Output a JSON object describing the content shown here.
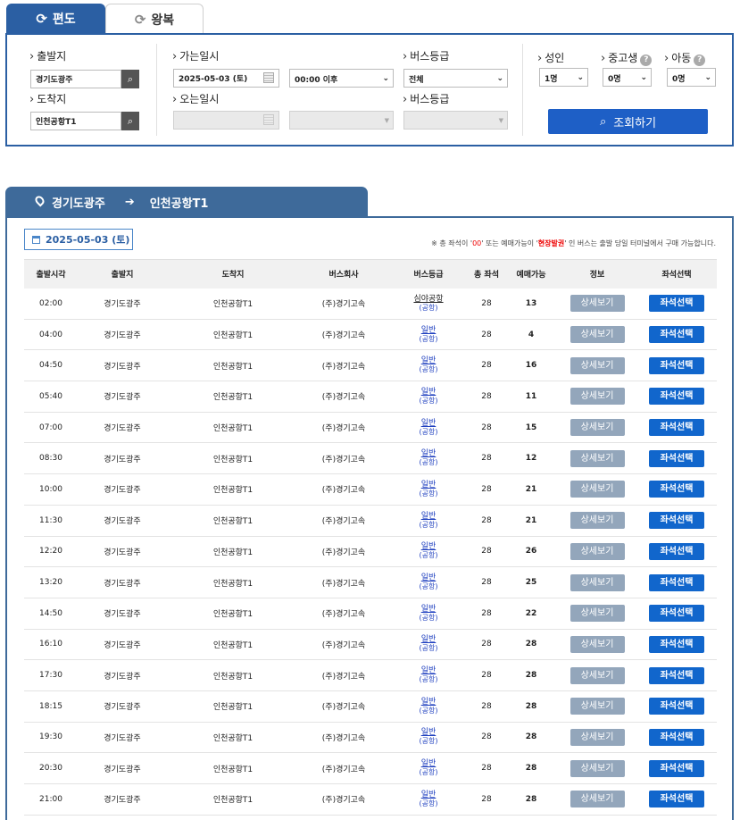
{
  "tabs": [
    {
      "label": "편도",
      "active": true
    },
    {
      "label": "왕복",
      "active": false
    }
  ],
  "search": {
    "departure_label": "출발지",
    "departure_value": "경기도광주",
    "arrival_label": "도착지",
    "arrival_value": "인천공항T1",
    "go_date_label": "가는일시",
    "go_date_value": "2025-05-03 (토)",
    "go_time_value": "00:00 이후",
    "return_date_label": "오는일시",
    "bus_grade_label": "버스등급",
    "bus_grade_value": "전체",
    "bus_grade2_label": "버스등급",
    "adult_label": "성인",
    "adult_value": "1명",
    "youth_label": "중고생",
    "youth_value": "0명",
    "child_label": "아동",
    "child_value": "0명",
    "inquiry_label": "조회하기"
  },
  "route": {
    "from": "경기도광주",
    "to": "인천공항T1"
  },
  "list": {
    "date": "2025-05-03 (토)",
    "notice_pre": "※ 총 좌석이 '",
    "notice_zero": "00",
    "notice_mid": "' 또는 예매가능이 '",
    "notice_onsite": "현장발권",
    "notice_post": "' 인 버스는 출발 당일 터미널에서 구매 가능합니다.",
    "headers": [
      "출발시각",
      "출발지",
      "도착지",
      "버스회사",
      "버스등급",
      "총 좌석",
      "예매가능",
      "정보",
      "좌석선택"
    ],
    "detail_label": "상세보기",
    "seat_label": "좌석선택",
    "rows": [
      {
        "time": "02:00",
        "from": "경기도광주",
        "to": "인천공항T1",
        "company": "(주)경기고속",
        "grade": "심야공항",
        "grade_sub": "(공항)",
        "total": "28",
        "avail": "13"
      },
      {
        "time": "04:00",
        "from": "경기도광주",
        "to": "인천공항T1",
        "company": "(주)경기고속",
        "grade": "일반",
        "grade_sub": "(공항)",
        "total": "28",
        "avail": "4"
      },
      {
        "time": "04:50",
        "from": "경기도광주",
        "to": "인천공항T1",
        "company": "(주)경기고속",
        "grade": "일반",
        "grade_sub": "(공항)",
        "total": "28",
        "avail": "16"
      },
      {
        "time": "05:40",
        "from": "경기도광주",
        "to": "인천공항T1",
        "company": "(주)경기고속",
        "grade": "일반",
        "grade_sub": "(공항)",
        "total": "28",
        "avail": "11"
      },
      {
        "time": "07:00",
        "from": "경기도광주",
        "to": "인천공항T1",
        "company": "(주)경기고속",
        "grade": "일반",
        "grade_sub": "(공항)",
        "total": "28",
        "avail": "15"
      },
      {
        "time": "08:30",
        "from": "경기도광주",
        "to": "인천공항T1",
        "company": "(주)경기고속",
        "grade": "일반",
        "grade_sub": "(공항)",
        "total": "28",
        "avail": "12"
      },
      {
        "time": "10:00",
        "from": "경기도광주",
        "to": "인천공항T1",
        "company": "(주)경기고속",
        "grade": "일반",
        "grade_sub": "(공항)",
        "total": "28",
        "avail": "21"
      },
      {
        "time": "11:30",
        "from": "경기도광주",
        "to": "인천공항T1",
        "company": "(주)경기고속",
        "grade": "일반",
        "grade_sub": "(공항)",
        "total": "28",
        "avail": "21"
      },
      {
        "time": "12:20",
        "from": "경기도광주",
        "to": "인천공항T1",
        "company": "(주)경기고속",
        "grade": "일반",
        "grade_sub": "(공항)",
        "total": "28",
        "avail": "26"
      },
      {
        "time": "13:20",
        "from": "경기도광주",
        "to": "인천공항T1",
        "company": "(주)경기고속",
        "grade": "일반",
        "grade_sub": "(공항)",
        "total": "28",
        "avail": "25"
      },
      {
        "time": "14:50",
        "from": "경기도광주",
        "to": "인천공항T1",
        "company": "(주)경기고속",
        "grade": "일반",
        "grade_sub": "(공항)",
        "total": "28",
        "avail": "22"
      },
      {
        "time": "16:10",
        "from": "경기도광주",
        "to": "인천공항T1",
        "company": "(주)경기고속",
        "grade": "일반",
        "grade_sub": "(공항)",
        "total": "28",
        "avail": "28"
      },
      {
        "time": "17:30",
        "from": "경기도광주",
        "to": "인천공항T1",
        "company": "(주)경기고속",
        "grade": "일반",
        "grade_sub": "(공항)",
        "total": "28",
        "avail": "28"
      },
      {
        "time": "18:15",
        "from": "경기도광주",
        "to": "인천공항T1",
        "company": "(주)경기고속",
        "grade": "일반",
        "grade_sub": "(공항)",
        "total": "28",
        "avail": "28"
      },
      {
        "time": "19:30",
        "from": "경기도광주",
        "to": "인천공항T1",
        "company": "(주)경기고속",
        "grade": "일반",
        "grade_sub": "(공항)",
        "total": "28",
        "avail": "28"
      },
      {
        "time": "20:30",
        "from": "경기도광주",
        "to": "인천공항T1",
        "company": "(주)경기고속",
        "grade": "일반",
        "grade_sub": "(공항)",
        "total": "28",
        "avail": "28"
      },
      {
        "time": "21:00",
        "from": "경기도광주",
        "to": "인천공항T1",
        "company": "(주)경기고속",
        "grade": "일반",
        "grade_sub": "(공항)",
        "total": "28",
        "avail": "28"
      }
    ]
  }
}
